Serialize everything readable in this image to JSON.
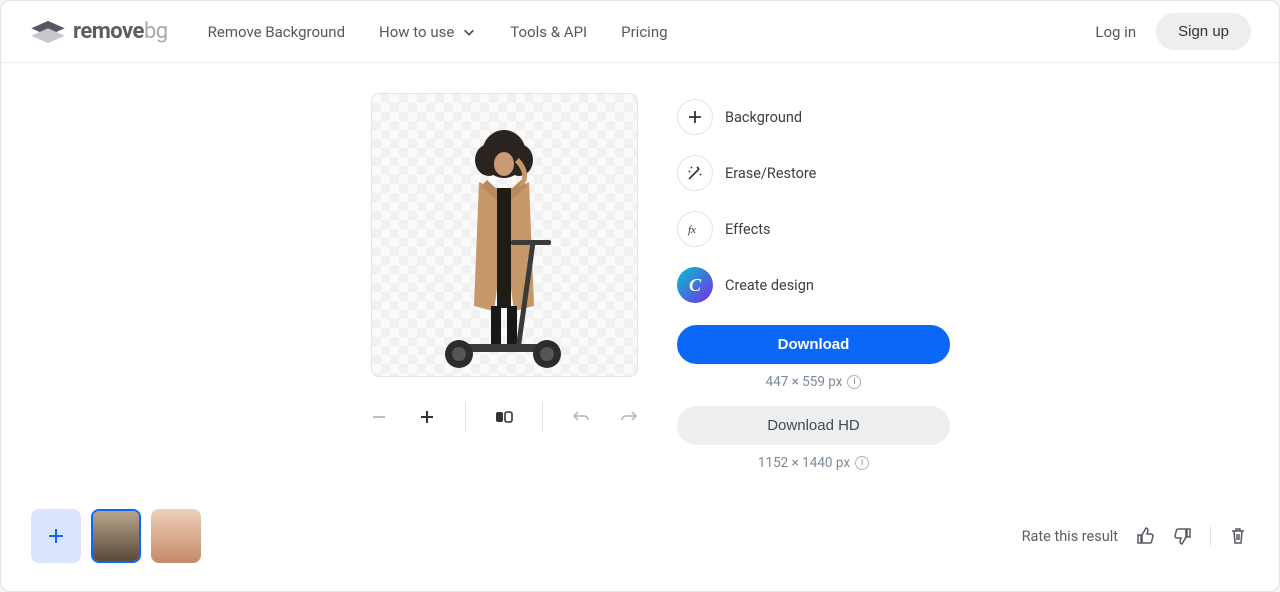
{
  "logo": {
    "name": "remove",
    "suffix": "bg"
  },
  "nav": {
    "remove_bg": "Remove Background",
    "how_to_use": "How to use",
    "tools_api": "Tools & API",
    "pricing": "Pricing"
  },
  "auth": {
    "login": "Log in",
    "signup": "Sign up"
  },
  "tools": {
    "background": "Background",
    "erase_restore": "Erase/Restore",
    "effects": "Effects",
    "create_design": "Create design"
  },
  "download": {
    "primary": "Download",
    "primary_dims": "447 × 559 px",
    "hd": "Download HD",
    "hd_dims": "1152 × 1440 px"
  },
  "footer": {
    "rate": "Rate this result"
  }
}
